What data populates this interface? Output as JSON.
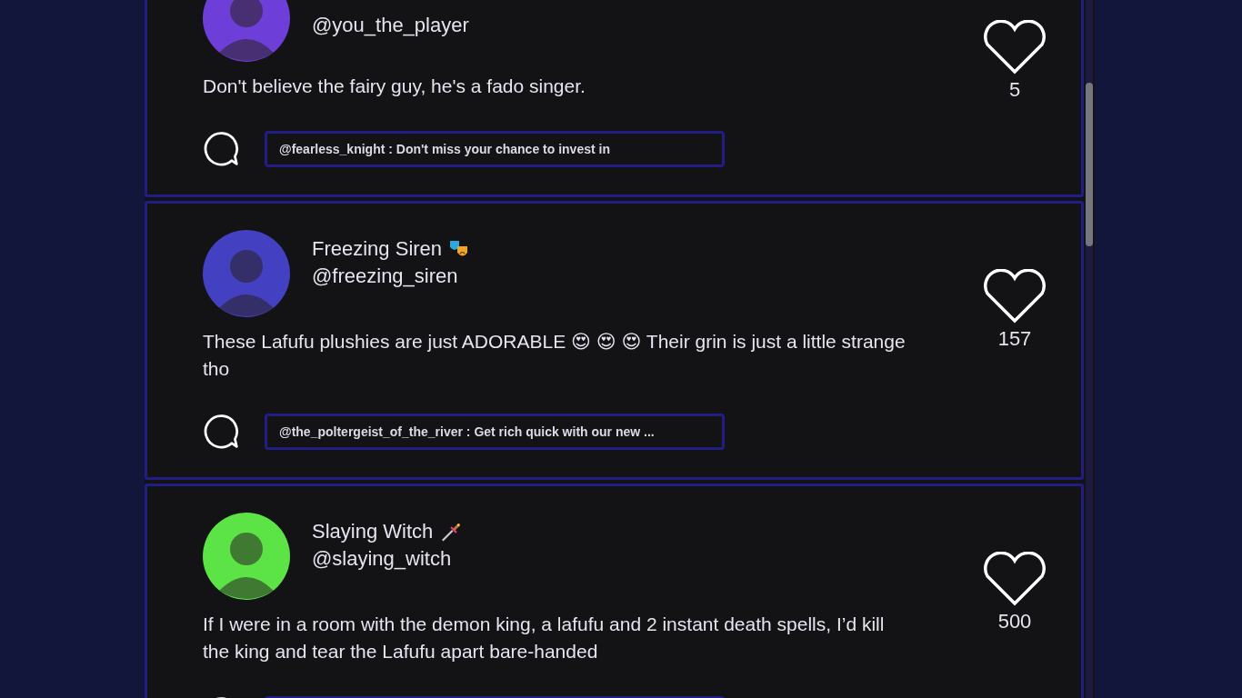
{
  "posts": [
    {
      "avatar": {
        "color": "#6e3fd8"
      },
      "handle": "@you_the_player",
      "text": "Don't believe the fairy guy, he's a fado singer.",
      "likes": "5",
      "comment_preview": "@fearless_knight : Don't miss your chance to invest in"
    },
    {
      "avatar": {
        "color": "#4341c2"
      },
      "name": "Freezing Siren",
      "name_icon": {
        "kind": "masks"
      },
      "handle": "@freezing_siren",
      "text": "These Lafufu plushies are just ADORABLE 😍 😍 😍 Their grin is just a little strange tho",
      "likes": "157",
      "comment_preview": "@the_poltergeist_of_the_river : Get rich quick with our new ..."
    },
    {
      "avatar": {
        "color": "#5ce446"
      },
      "name": "Slaying Witch",
      "name_icon": {
        "kind": "dagger"
      },
      "handle": "@slaying_witch",
      "text": "If I were in a room with the demon king, a lafufu and 2 instant death spells, I’d kill the king and tear the Lafufu apart bare-handed",
      "likes": "500"
    }
  ]
}
